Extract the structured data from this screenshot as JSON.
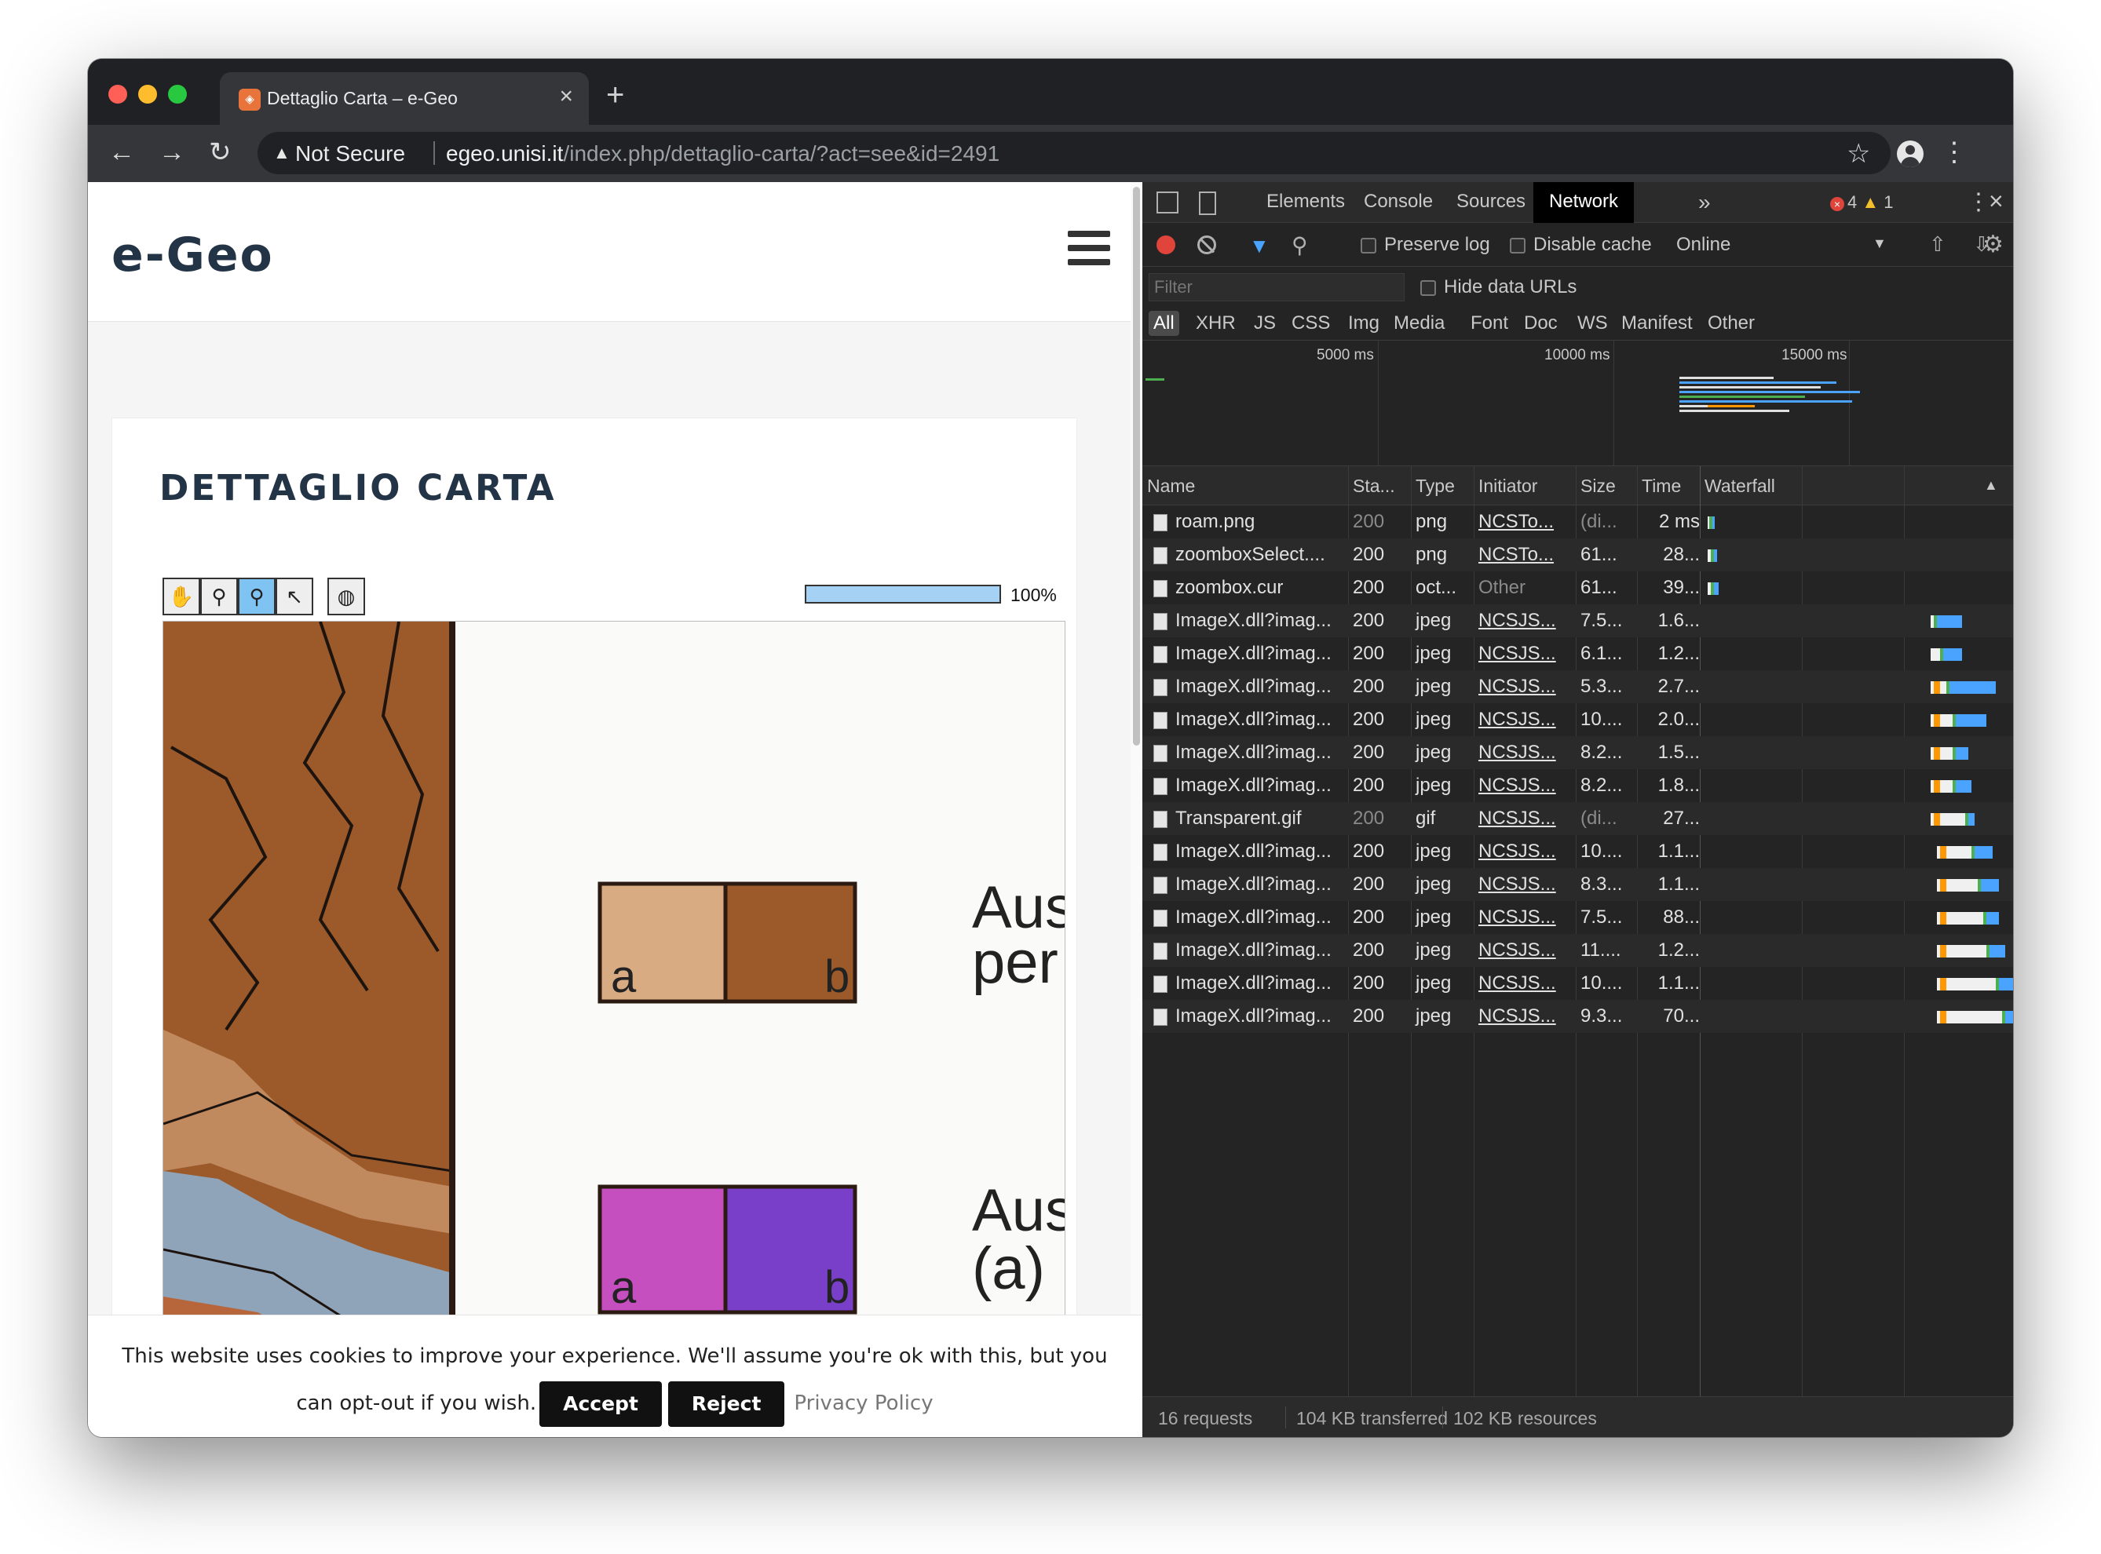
{
  "browser": {
    "tab_title": "Dettaglio Carta – e-Geo",
    "tab_close": "×",
    "new_tab": "+",
    "not_secure": "Not Secure",
    "url_host": "egeo.unisi.it",
    "url_path": "/index.php/dettaglio-carta/?act=see&id=2491"
  },
  "page": {
    "logo": "e-Geo",
    "title": "DETTAGLIO CARTA",
    "progress": {
      "value": 100,
      "label": "100%"
    },
    "map": {
      "legend_a": "a",
      "legend_b": "b",
      "text1_line1": "Aus",
      "text1_line2": "per",
      "text2_line1": "Aus",
      "text2_line2": "(a) :",
      "colors": {
        "brown": "#9c5a2b",
        "tan": "#d9ab82",
        "magenta": "#c64fc0",
        "purple": "#7a3fc9",
        "slate": "#8fa4b8"
      }
    },
    "cookie": {
      "text": "This website uses cookies to improve your experience. We'll assume you're ok with this, but you can opt-out if you wish.",
      "accept": "Accept",
      "reject": "Reject",
      "privacy": "Privacy Policy"
    }
  },
  "devtools": {
    "tabs": [
      "Elements",
      "Console",
      "Sources",
      "Network"
    ],
    "active_tab": "Network",
    "more": "»",
    "errors": "4",
    "warnings": "1",
    "preserve_log": "Preserve log",
    "disable_cache": "Disable cache",
    "throttle": "Online",
    "filter_placeholder": "Filter",
    "hide_data_urls": "Hide data URLs",
    "types": [
      "All",
      "XHR",
      "JS",
      "CSS",
      "Img",
      "Media",
      "Font",
      "Doc",
      "WS",
      "Manifest",
      "Other"
    ],
    "overview_ticks": [
      "5000 ms",
      "10000 ms",
      "15000 ms"
    ],
    "columns": [
      "Name",
      "Sta...",
      "Type",
      "Initiator",
      "Size",
      "Time",
      "Waterfall"
    ],
    "rows": [
      {
        "name": "roam.png",
        "status": "200",
        "type": "png",
        "initiator": "NCSTo...",
        "size": "(di...",
        "time": "2 ms",
        "dim": true,
        "wf": [
          0.02,
          0.005,
          0.0
        ]
      },
      {
        "name": "zoomboxSelect....",
        "status": "200",
        "type": "png",
        "initiator": "NCSTo...",
        "size": "61...",
        "time": "28...",
        "dim": false,
        "wf": [
          0.02,
          0.01,
          0.01
        ]
      },
      {
        "name": "zoombox.cur",
        "status": "200",
        "type": "oct...",
        "initiator": "Other",
        "size": "61...",
        "time": "39...",
        "dim": false,
        "wf": [
          0.02,
          0.01,
          0.015
        ]
      },
      {
        "name": "ImageX.dll?imag...",
        "status": "200",
        "type": "jpeg",
        "initiator": "NCSJS...",
        "size": "7.5...",
        "time": "1.6...",
        "dim": false,
        "wf": [
          0.74,
          0.01,
          0.08
        ]
      },
      {
        "name": "ImageX.dll?imag...",
        "status": "200",
        "type": "jpeg",
        "initiator": "NCSJS...",
        "size": "6.1...",
        "time": "1.2...",
        "dim": false,
        "wf": [
          0.74,
          0.03,
          0.06
        ]
      },
      {
        "name": "ImageX.dll?imag...",
        "status": "200",
        "type": "jpeg",
        "initiator": "NCSJS...",
        "size": "5.3...",
        "time": "2.7...",
        "dim": false,
        "wf": [
          0.74,
          0.05,
          0.15
        ]
      },
      {
        "name": "ImageX.dll?imag...",
        "status": "200",
        "type": "jpeg",
        "initiator": "NCSJS...",
        "size": "10....",
        "time": "2.0...",
        "dim": false,
        "wf": [
          0.74,
          0.07,
          0.1
        ]
      },
      {
        "name": "ImageX.dll?imag...",
        "status": "200",
        "type": "jpeg",
        "initiator": "NCSJS...",
        "size": "8.2...",
        "time": "1.5...",
        "dim": false,
        "wf": [
          0.74,
          0.07,
          0.04
        ]
      },
      {
        "name": "ImageX.dll?imag...",
        "status": "200",
        "type": "jpeg",
        "initiator": "NCSJS...",
        "size": "8.2...",
        "time": "1.8...",
        "dim": false,
        "wf": [
          0.74,
          0.07,
          0.05
        ]
      },
      {
        "name": "Transparent.gif",
        "status": "200",
        "type": "gif",
        "initiator": "NCSJS...",
        "size": "(di...",
        "time": "27...",
        "dim": true,
        "wf": [
          0.74,
          0.11,
          0.02
        ]
      },
      {
        "name": "ImageX.dll?imag...",
        "status": "200",
        "type": "jpeg",
        "initiator": "NCSJS...",
        "size": "10....",
        "time": "1.1...",
        "dim": false,
        "wf": [
          0.76,
          0.11,
          0.06
        ]
      },
      {
        "name": "ImageX.dll?imag...",
        "status": "200",
        "type": "jpeg",
        "initiator": "NCSJS...",
        "size": "8.3...",
        "time": "1.1...",
        "dim": false,
        "wf": [
          0.76,
          0.13,
          0.06
        ]
      },
      {
        "name": "ImageX.dll?imag...",
        "status": "200",
        "type": "jpeg",
        "initiator": "NCSJS...",
        "size": "7.5...",
        "time": "88...",
        "dim": false,
        "wf": [
          0.76,
          0.15,
          0.04
        ]
      },
      {
        "name": "ImageX.dll?imag...",
        "status": "200",
        "type": "jpeg",
        "initiator": "NCSJS...",
        "size": "11....",
        "time": "1.2...",
        "dim": false,
        "wf": [
          0.76,
          0.16,
          0.05
        ]
      },
      {
        "name": "ImageX.dll?imag...",
        "status": "200",
        "type": "jpeg",
        "initiator": "NCSJS...",
        "size": "10....",
        "time": "1.1...",
        "dim": false,
        "wf": [
          0.76,
          0.19,
          0.05
        ]
      },
      {
        "name": "ImageX.dll?imag...",
        "status": "200",
        "type": "jpeg",
        "initiator": "NCSJS...",
        "size": "9.3...",
        "time": "70...",
        "dim": false,
        "wf": [
          0.76,
          0.21,
          0.03
        ]
      }
    ],
    "status": {
      "requests": "16 requests",
      "transferred": "104 KB transferred",
      "resources": "102 KB resources"
    }
  }
}
